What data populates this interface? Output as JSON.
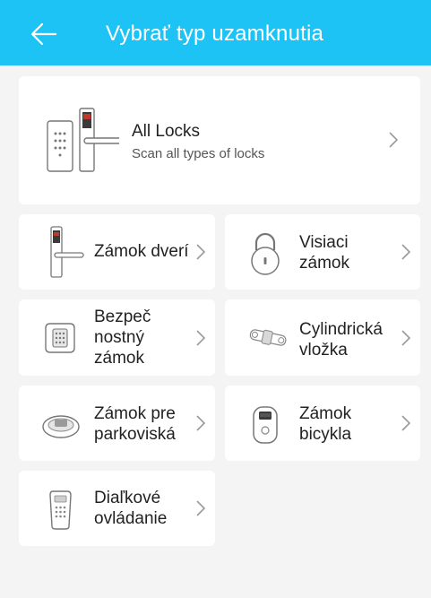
{
  "header": {
    "title": "Vybrať typ uzamknutia"
  },
  "all_locks": {
    "title": "All Locks",
    "subtitle": "Scan all types of locks"
  },
  "items": [
    {
      "label": "Zámok dverí"
    },
    {
      "label": "Visiaci zámok"
    },
    {
      "label": "Bezpečnostný zámok",
      "lines": [
        "Bezpeč",
        "nostný",
        "zámok"
      ]
    },
    {
      "label": "Cylindrická vložka",
      "lines": [
        "Cylindrická",
        "vložka"
      ]
    },
    {
      "label": "Zámok pre parkoviská",
      "lines": [
        "Zámok pre",
        "parkoviská"
      ]
    },
    {
      "label": "Zámok bicykla",
      "lines": [
        "Zámok",
        "bicykla"
      ]
    },
    {
      "label": "Diaľkové ovládanie",
      "lines": [
        "Diaľkové",
        "ovládanie"
      ]
    }
  ],
  "item_lines": {
    "padlock": [
      "Visiaci",
      "zámok"
    ]
  },
  "colors": {
    "header": "#1ec3f5",
    "background": "#f4f4f4"
  }
}
